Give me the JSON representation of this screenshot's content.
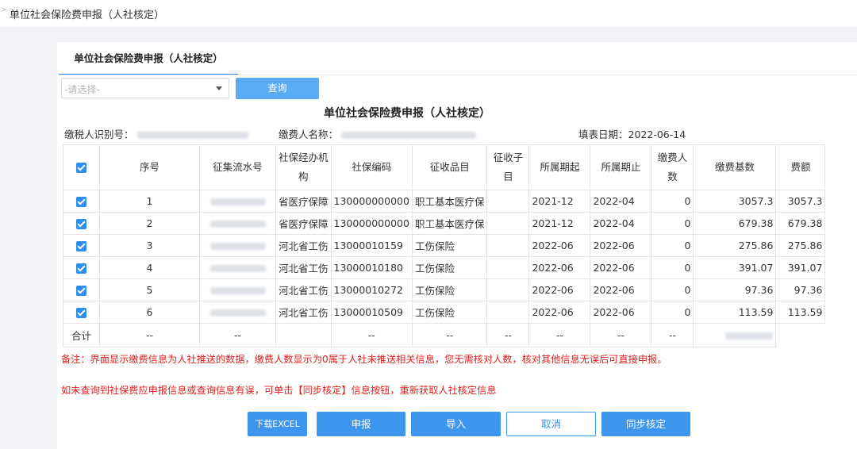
{
  "breadcrumb": {
    "separator": ">",
    "text": "单位社会保险费申报（人社核定）"
  },
  "tab": {
    "label": "单位社会保险费申报（人社核定）"
  },
  "select": {
    "placeholder": "-请选择-"
  },
  "query_button": "查询",
  "form_title": "单位社会保险费申报（人社核定）",
  "info": {
    "taxpayer_id_label": "缴税人识别号：",
    "payer_name_label": "缴费人名称：",
    "fill_date_label": "填表日期：",
    "fill_date": "2022-06-14"
  },
  "table": {
    "headers": [
      "序号",
      "征集流水号",
      "社保经办机构",
      "社保编码",
      "征收品目",
      "征收子目",
      "所属期起",
      "所属期止",
      "缴费人数",
      "缴费基数",
      "费额"
    ],
    "rows": [
      {
        "seq": "1",
        "org": "省医疗保障",
        "code": "130000000000",
        "item": "职工基本医疗保",
        "sub": "",
        "start": "2021-12",
        "end": "2022-04",
        "count": "0",
        "base": "3057.3",
        "fee": "3057.3"
      },
      {
        "seq": "2",
        "org": "省医疗保障",
        "code": "130000000000",
        "item": "职工基本医疗保",
        "sub": "",
        "start": "2021-12",
        "end": "2022-04",
        "count": "0",
        "base": "679.38",
        "fee": "679.38"
      },
      {
        "seq": "3",
        "org": "河北省工伤",
        "code": "13000010159",
        "item": "工伤保险",
        "sub": "",
        "start": "2022-06",
        "end": "2022-06",
        "count": "0",
        "base": "275.86",
        "fee": "275.86"
      },
      {
        "seq": "4",
        "org": "河北省工伤",
        "code": "13000010180",
        "item": "工伤保险",
        "sub": "",
        "start": "2022-06",
        "end": "2022-06",
        "count": "0",
        "base": "391.07",
        "fee": "391.07"
      },
      {
        "seq": "5",
        "org": "河北省工伤",
        "code": "13000010272",
        "item": "工伤保险",
        "sub": "",
        "start": "2022-06",
        "end": "2022-06",
        "count": "0",
        "base": "97.36",
        "fee": "97.36"
      },
      {
        "seq": "6",
        "org": "河北省工伤",
        "code": "13000010509",
        "item": "工伤保险",
        "sub": "",
        "start": "2022-06",
        "end": "2022-06",
        "count": "0",
        "base": "113.59",
        "fee": "113.59"
      }
    ],
    "total": {
      "label": "合计",
      "dash": "--"
    }
  },
  "notes": {
    "note1": "备注：界面显示缴费信息为人社推送的数据，缴费人数显示为0属于人社未推送相关信息，您无需核对人数，核对其他信息无误后可直接申报。",
    "note2": "如未查询到社保费应申报信息或查询信息有误，可单击【同步核定】信息按钮，重新获取人社核定信息"
  },
  "buttons": {
    "download": "下载EXCEL",
    "declare": "申报",
    "import": "导入",
    "cancel": "取消",
    "sync": "同步核定"
  },
  "colors": {
    "accent": "#2f8ef2",
    "query_button": "#5aacf2",
    "warning_text": "#e02020"
  }
}
